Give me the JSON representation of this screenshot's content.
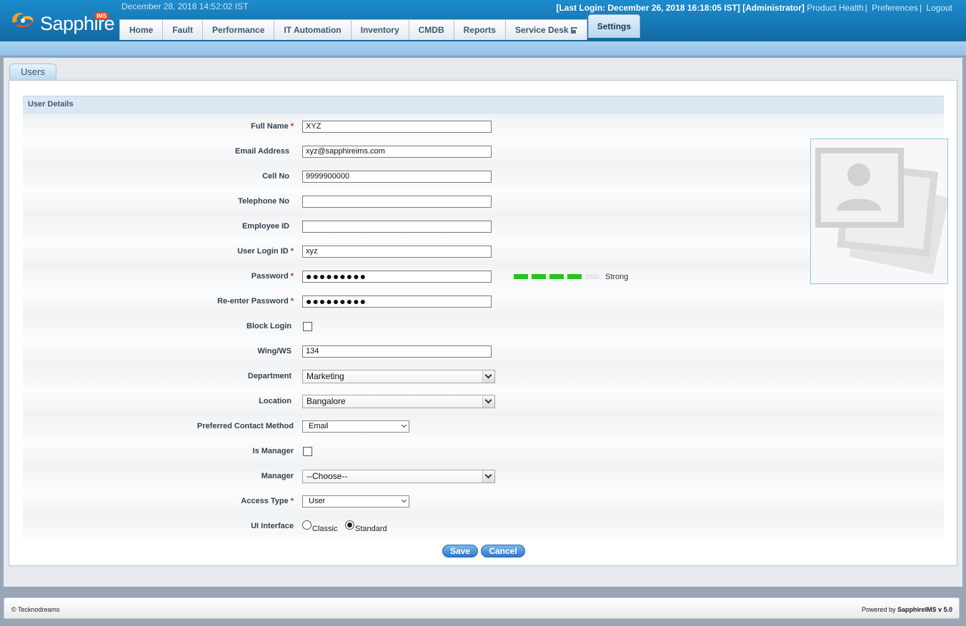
{
  "header": {
    "brand": "Sapphire",
    "brand_badge": "IMS",
    "datetime": "December 28, 2018 14:52:02 IST",
    "last_login": "[Last Login: December 26, 2018 16:18:05 IST] [Administrator]",
    "links": {
      "product_health": "Product Health",
      "preferences": "Preferences",
      "logout": "Logout"
    },
    "link_sep": "|"
  },
  "nav": {
    "tabs": [
      {
        "label": "Home"
      },
      {
        "label": "Fault"
      },
      {
        "label": "Performance"
      },
      {
        "label": "IT Automation"
      },
      {
        "label": "Inventory"
      },
      {
        "label": "CMDB"
      },
      {
        "label": "Reports"
      },
      {
        "label": "Service Desk",
        "icon": "external-link-icon"
      },
      {
        "label": "Settings",
        "active": true
      }
    ]
  },
  "page": {
    "tab": "Users",
    "section_title": "User Details"
  },
  "form": {
    "full_name": {
      "label": "Full Name",
      "value": "XYZ"
    },
    "email": {
      "label": "Email Address",
      "value": "xyz@sapphireims.com"
    },
    "cell": {
      "label": "Cell No",
      "value": "9999900000"
    },
    "telephone": {
      "label": "Telephone No",
      "value": ""
    },
    "employee_id": {
      "label": "Employee ID",
      "value": ""
    },
    "login_id": {
      "label": "User Login ID",
      "value": "xyz"
    },
    "password": {
      "label": "Password",
      "value": "●●●●●●●●●",
      "strength_label": "Strong",
      "strength_level": 4,
      "strength_max": 5
    },
    "reenter_password": {
      "label": "Re-enter Password",
      "value": "●●●●●●●●●"
    },
    "block_login": {
      "label": "Block Login",
      "checked": false
    },
    "wing": {
      "label": "Wing/WS",
      "value": "134"
    },
    "department": {
      "label": "Department",
      "value": "Marketing"
    },
    "location": {
      "label": "Location",
      "value": "Bangalore"
    },
    "contact_method": {
      "label": "Preferred Contact Method",
      "value": "Email"
    },
    "is_manager": {
      "label": "Is Manager",
      "checked": false
    },
    "manager": {
      "label": "Manager",
      "value": "--Choose--"
    },
    "access_type": {
      "label": "Access Type",
      "value": "User"
    },
    "ui_interface": {
      "label": "UI Interface",
      "options": [
        "Classic",
        "Standard"
      ],
      "selected": "Standard"
    },
    "required_mark": "*"
  },
  "buttons": {
    "save": "Save",
    "cancel": "Cancel"
  },
  "footer": {
    "copyright": "© Tecknodreams",
    "powered_prefix": "Powered by",
    "powered_product": "SapphireIMS v 5.0"
  },
  "colors": {
    "header": "#1677b5",
    "strength_on": "#23c41c",
    "strength_off": "#e5e7ea",
    "required": "#d62020",
    "button": "#2f79cb"
  }
}
